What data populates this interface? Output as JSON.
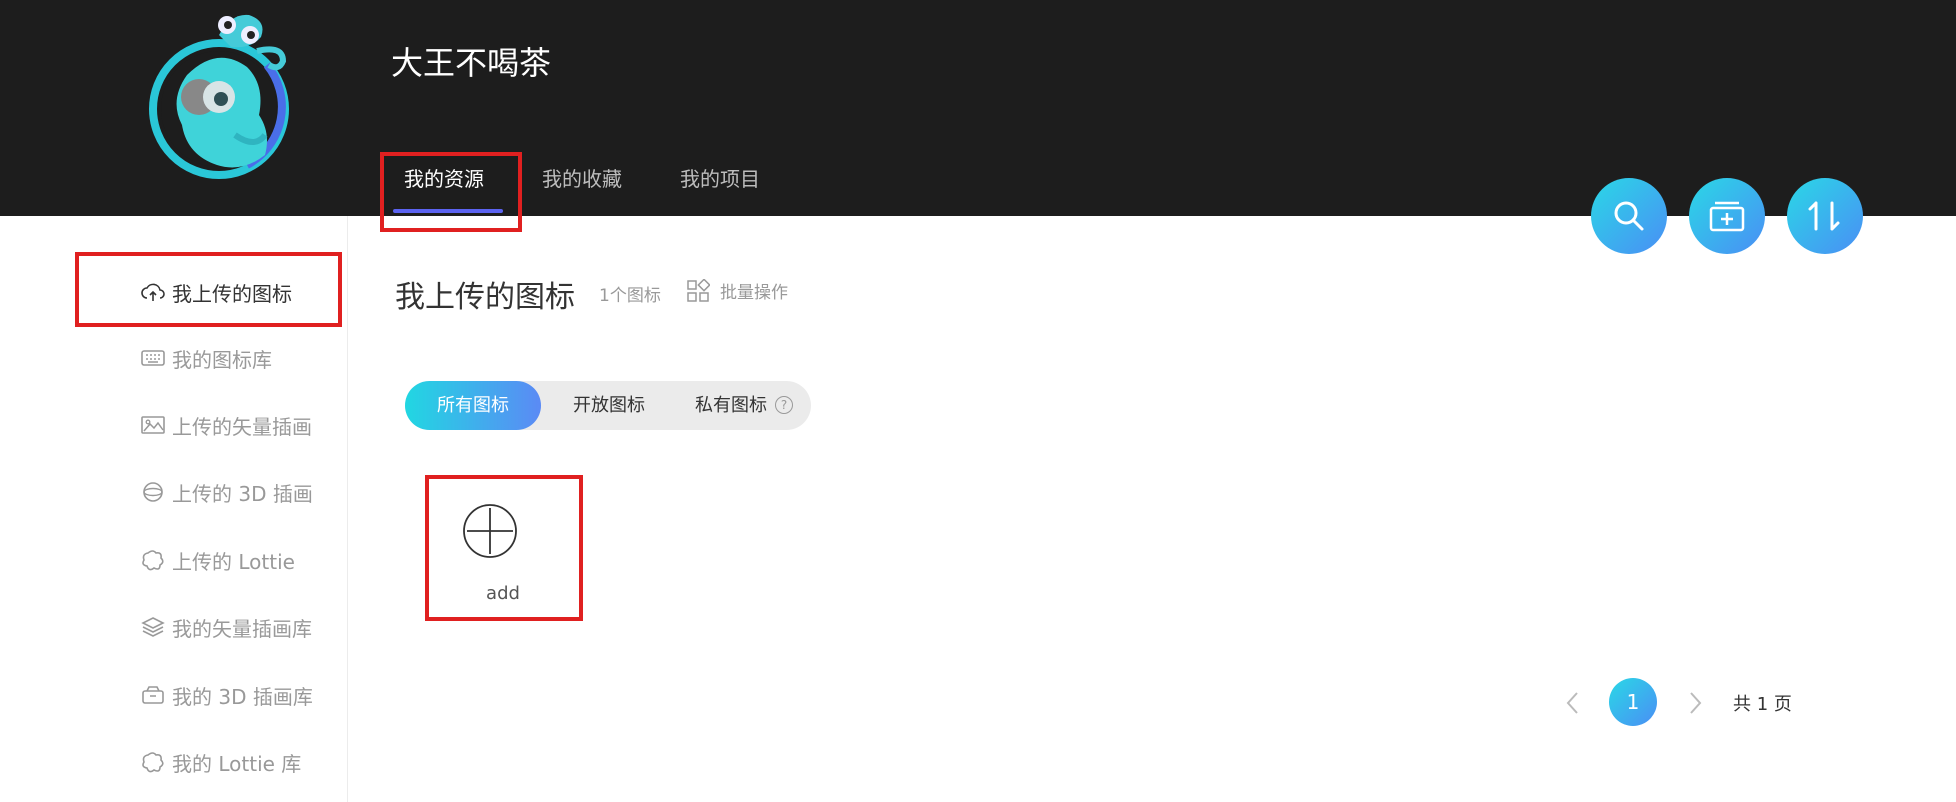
{
  "header": {
    "username": "大王不喝茶",
    "tabs": [
      {
        "label": "我的资源",
        "active": true
      },
      {
        "label": "我的收藏",
        "active": false
      },
      {
        "label": "我的项目",
        "active": false
      }
    ],
    "actions": [
      {
        "icon": "search-icon"
      },
      {
        "icon": "add-to-library-icon"
      },
      {
        "icon": "sort-icon"
      }
    ]
  },
  "sidebar": {
    "items": [
      {
        "label": "我上传的图标",
        "icon": "upload-cloud-icon",
        "active": true
      },
      {
        "label": "我的图标库",
        "icon": "keyboard-icon"
      },
      {
        "label": "上传的矢量插画",
        "icon": "image-icon"
      },
      {
        "label": "上传的 3D 插画",
        "icon": "sphere-icon"
      },
      {
        "label": "上传的 Lottie",
        "icon": "lottie-icon"
      },
      {
        "label": "我的矢量插画库",
        "icon": "layers-icon"
      },
      {
        "label": "我的 3D 插画库",
        "icon": "box-icon"
      },
      {
        "label": "我的 Lottie 库",
        "icon": "lottie-icon"
      }
    ]
  },
  "main": {
    "title": "我上传的图标",
    "count": "1个图标",
    "batch": "批量操作",
    "filters": [
      {
        "label": "所有图标",
        "active": true
      },
      {
        "label": "开放图标"
      },
      {
        "label": "私有图标",
        "help": "?"
      }
    ],
    "add_card": {
      "label": "add",
      "icon": "add-circle-icon"
    }
  },
  "pagination": {
    "current": "1",
    "total": "共 1 页"
  },
  "colors": {
    "header_bg": "#1d1d1d",
    "accent": "#5b63f0",
    "gradient_start": "#21d7e2",
    "gradient_end": "#5b8af5",
    "highlight": "#e02020"
  }
}
